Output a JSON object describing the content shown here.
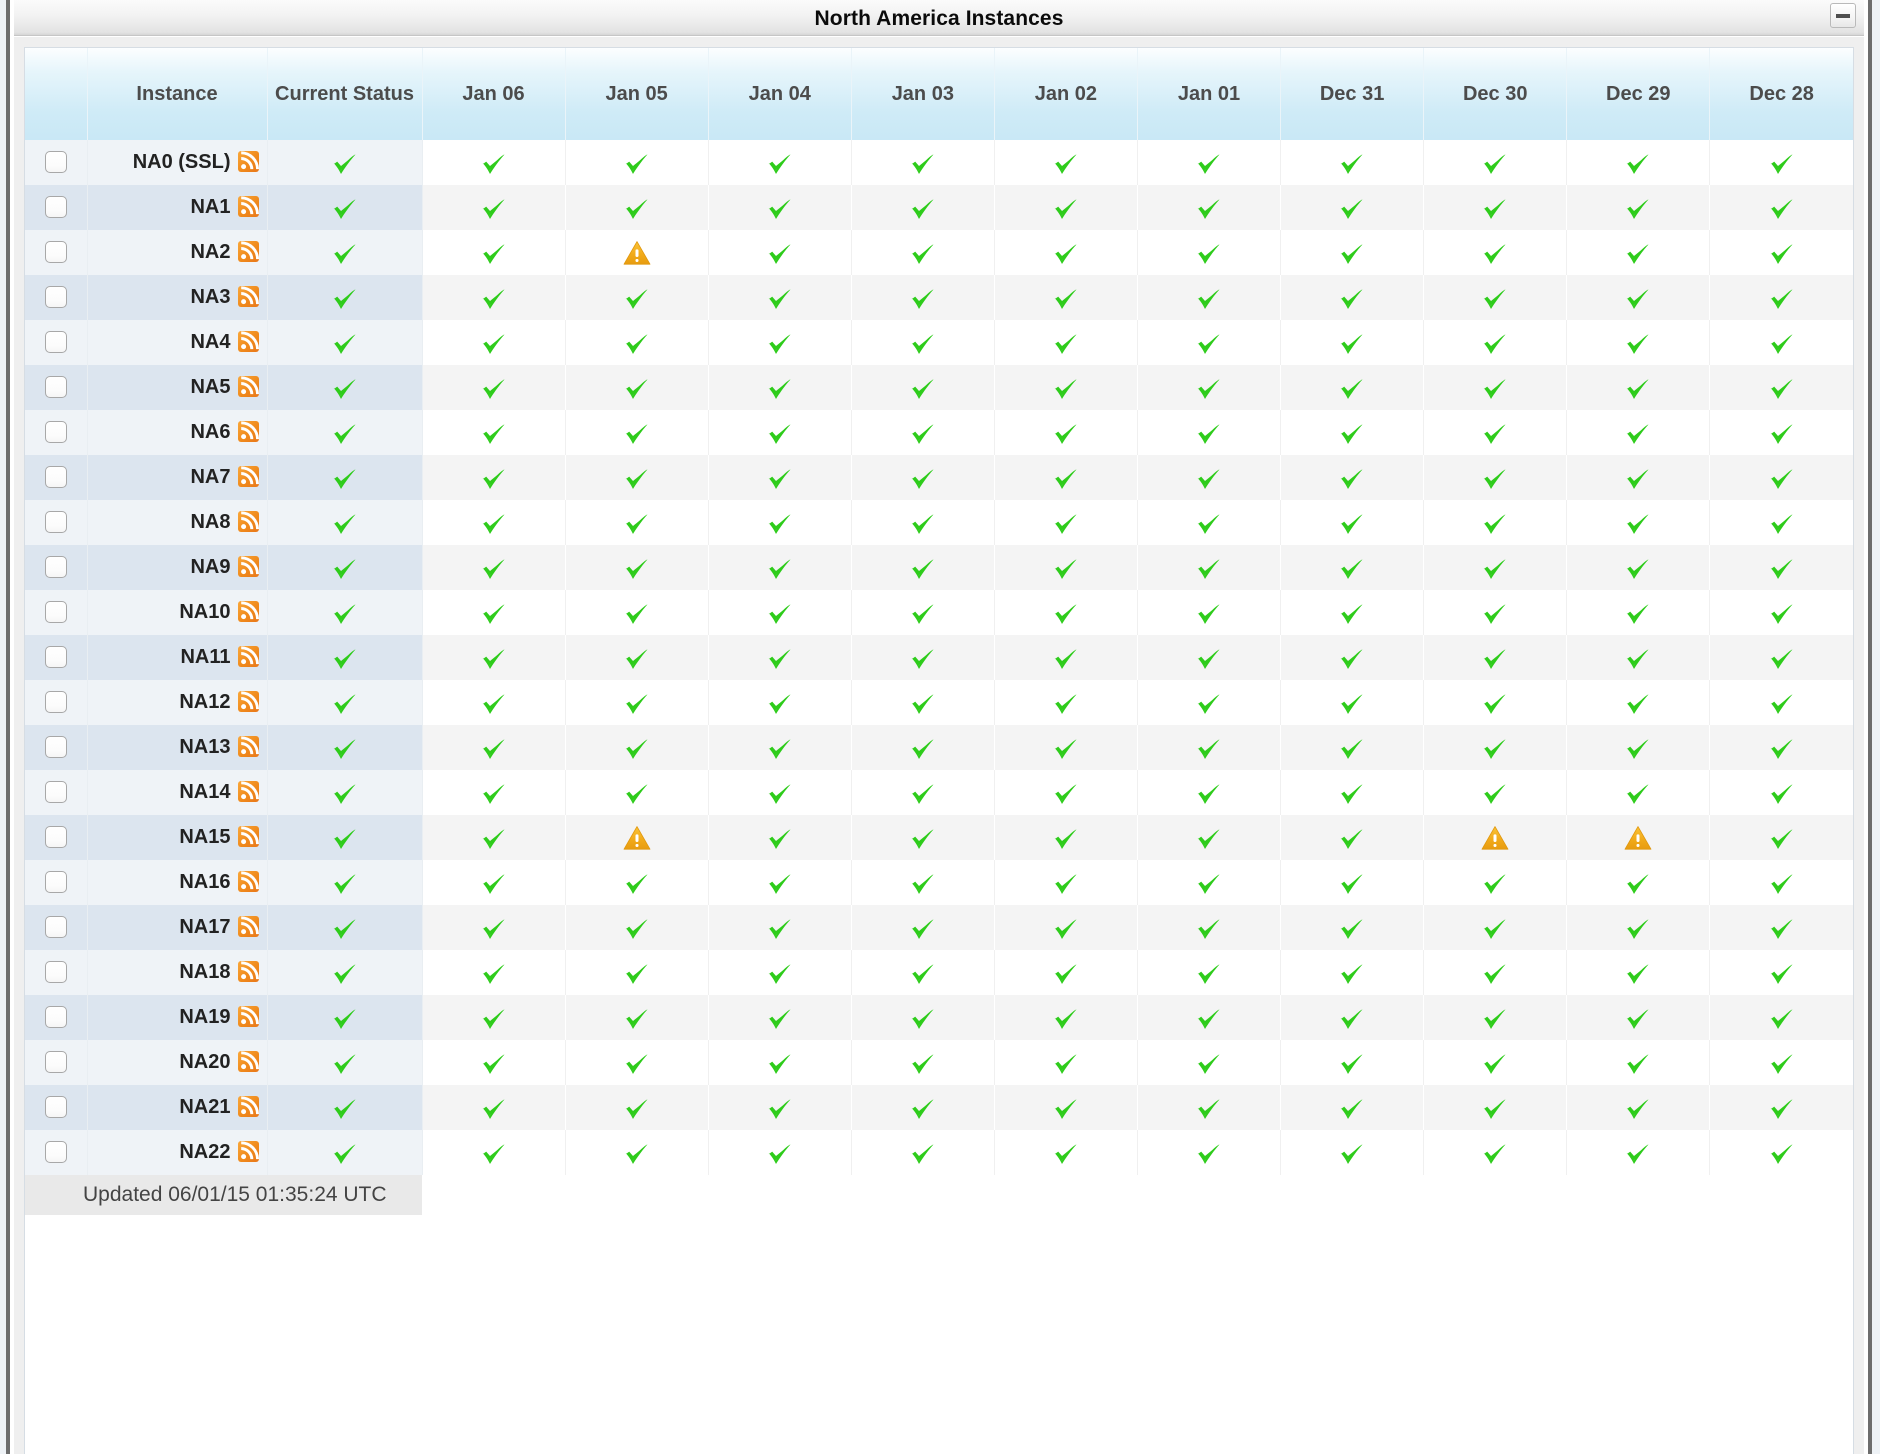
{
  "window": {
    "title": "North America Instances",
    "minimize_label": "–"
  },
  "colors": {
    "header_gradient_top": "#fcfeff",
    "header_gradient_bottom": "#c9e8f6",
    "row_odd_left": "#eff3f7",
    "row_even_left": "#dce5ef",
    "row_odd_day": "#ffffff",
    "row_even_day": "#f4f4f4",
    "ok_green": "#2ecc1b",
    "warn_amber": "#f0a71c",
    "rss_orange": "#f08a1c",
    "frame_gray": "#6d6d6d"
  },
  "table": {
    "columns": [
      {
        "key": "check",
        "label": ""
      },
      {
        "key": "inst",
        "label": "Instance"
      },
      {
        "key": "status",
        "label": "Current Status"
      },
      {
        "key": "d0",
        "label": "Jan 06"
      },
      {
        "key": "d1",
        "label": "Jan 05"
      },
      {
        "key": "d2",
        "label": "Jan 04"
      },
      {
        "key": "d3",
        "label": "Jan 03"
      },
      {
        "key": "d4",
        "label": "Jan 02"
      },
      {
        "key": "d5",
        "label": "Jan 01"
      },
      {
        "key": "d6",
        "label": "Dec 31"
      },
      {
        "key": "d7",
        "label": "Dec 30"
      },
      {
        "key": "d8",
        "label": "Dec 29"
      },
      {
        "key": "d9",
        "label": "Dec 28"
      }
    ],
    "icons": {
      "ok": "check-icon",
      "warn": "warning-icon",
      "feed": "rss-feed-icon",
      "checkbox": "row-checkbox"
    },
    "rows": [
      {
        "instance": "NA0 (SSL)",
        "checked": false,
        "feed": true,
        "current": "ok",
        "days": [
          "ok",
          "ok",
          "ok",
          "ok",
          "ok",
          "ok",
          "ok",
          "ok",
          "ok",
          "ok"
        ]
      },
      {
        "instance": "NA1",
        "checked": false,
        "feed": true,
        "current": "ok",
        "days": [
          "ok",
          "ok",
          "ok",
          "ok",
          "ok",
          "ok",
          "ok",
          "ok",
          "ok",
          "ok"
        ]
      },
      {
        "instance": "NA2",
        "checked": false,
        "feed": true,
        "current": "ok",
        "days": [
          "ok",
          "warn",
          "ok",
          "ok",
          "ok",
          "ok",
          "ok",
          "ok",
          "ok",
          "ok"
        ]
      },
      {
        "instance": "NA3",
        "checked": false,
        "feed": true,
        "current": "ok",
        "days": [
          "ok",
          "ok",
          "ok",
          "ok",
          "ok",
          "ok",
          "ok",
          "ok",
          "ok",
          "ok"
        ]
      },
      {
        "instance": "NA4",
        "checked": false,
        "feed": true,
        "current": "ok",
        "days": [
          "ok",
          "ok",
          "ok",
          "ok",
          "ok",
          "ok",
          "ok",
          "ok",
          "ok",
          "ok"
        ]
      },
      {
        "instance": "NA5",
        "checked": false,
        "feed": true,
        "current": "ok",
        "days": [
          "ok",
          "ok",
          "ok",
          "ok",
          "ok",
          "ok",
          "ok",
          "ok",
          "ok",
          "ok"
        ]
      },
      {
        "instance": "NA6",
        "checked": false,
        "feed": true,
        "current": "ok",
        "days": [
          "ok",
          "ok",
          "ok",
          "ok",
          "ok",
          "ok",
          "ok",
          "ok",
          "ok",
          "ok"
        ]
      },
      {
        "instance": "NA7",
        "checked": false,
        "feed": true,
        "current": "ok",
        "days": [
          "ok",
          "ok",
          "ok",
          "ok",
          "ok",
          "ok",
          "ok",
          "ok",
          "ok",
          "ok"
        ]
      },
      {
        "instance": "NA8",
        "checked": false,
        "feed": true,
        "current": "ok",
        "days": [
          "ok",
          "ok",
          "ok",
          "ok",
          "ok",
          "ok",
          "ok",
          "ok",
          "ok",
          "ok"
        ]
      },
      {
        "instance": "NA9",
        "checked": false,
        "feed": true,
        "current": "ok",
        "days": [
          "ok",
          "ok",
          "ok",
          "ok",
          "ok",
          "ok",
          "ok",
          "ok",
          "ok",
          "ok"
        ]
      },
      {
        "instance": "NA10",
        "checked": false,
        "feed": true,
        "current": "ok",
        "days": [
          "ok",
          "ok",
          "ok",
          "ok",
          "ok",
          "ok",
          "ok",
          "ok",
          "ok",
          "ok"
        ]
      },
      {
        "instance": "NA11",
        "checked": false,
        "feed": true,
        "current": "ok",
        "days": [
          "ok",
          "ok",
          "ok",
          "ok",
          "ok",
          "ok",
          "ok",
          "ok",
          "ok",
          "ok"
        ]
      },
      {
        "instance": "NA12",
        "checked": false,
        "feed": true,
        "current": "ok",
        "days": [
          "ok",
          "ok",
          "ok",
          "ok",
          "ok",
          "ok",
          "ok",
          "ok",
          "ok",
          "ok"
        ]
      },
      {
        "instance": "NA13",
        "checked": false,
        "feed": true,
        "current": "ok",
        "days": [
          "ok",
          "ok",
          "ok",
          "ok",
          "ok",
          "ok",
          "ok",
          "ok",
          "ok",
          "ok"
        ]
      },
      {
        "instance": "NA14",
        "checked": false,
        "feed": true,
        "current": "ok",
        "days": [
          "ok",
          "ok",
          "ok",
          "ok",
          "ok",
          "ok",
          "ok",
          "ok",
          "ok",
          "ok"
        ]
      },
      {
        "instance": "NA15",
        "checked": false,
        "feed": true,
        "current": "ok",
        "days": [
          "ok",
          "warn",
          "ok",
          "ok",
          "ok",
          "ok",
          "ok",
          "warn",
          "warn",
          "ok"
        ]
      },
      {
        "instance": "NA16",
        "checked": false,
        "feed": true,
        "current": "ok",
        "days": [
          "ok",
          "ok",
          "ok",
          "ok",
          "ok",
          "ok",
          "ok",
          "ok",
          "ok",
          "ok"
        ]
      },
      {
        "instance": "NA17",
        "checked": false,
        "feed": true,
        "current": "ok",
        "days": [
          "ok",
          "ok",
          "ok",
          "ok",
          "ok",
          "ok",
          "ok",
          "ok",
          "ok",
          "ok"
        ]
      },
      {
        "instance": "NA18",
        "checked": false,
        "feed": true,
        "current": "ok",
        "days": [
          "ok",
          "ok",
          "ok",
          "ok",
          "ok",
          "ok",
          "ok",
          "ok",
          "ok",
          "ok"
        ]
      },
      {
        "instance": "NA19",
        "checked": false,
        "feed": true,
        "current": "ok",
        "days": [
          "ok",
          "ok",
          "ok",
          "ok",
          "ok",
          "ok",
          "ok",
          "ok",
          "ok",
          "ok"
        ]
      },
      {
        "instance": "NA20",
        "checked": false,
        "feed": true,
        "current": "ok",
        "days": [
          "ok",
          "ok",
          "ok",
          "ok",
          "ok",
          "ok",
          "ok",
          "ok",
          "ok",
          "ok"
        ]
      },
      {
        "instance": "NA21",
        "checked": false,
        "feed": true,
        "current": "ok",
        "days": [
          "ok",
          "ok",
          "ok",
          "ok",
          "ok",
          "ok",
          "ok",
          "ok",
          "ok",
          "ok"
        ]
      },
      {
        "instance": "NA22",
        "checked": false,
        "feed": true,
        "current": "ok",
        "days": [
          "ok",
          "ok",
          "ok",
          "ok",
          "ok",
          "ok",
          "ok",
          "ok",
          "ok",
          "ok"
        ]
      }
    ]
  },
  "footer": {
    "updated_text": "Updated 06/01/15 01:35:24 UTC"
  }
}
